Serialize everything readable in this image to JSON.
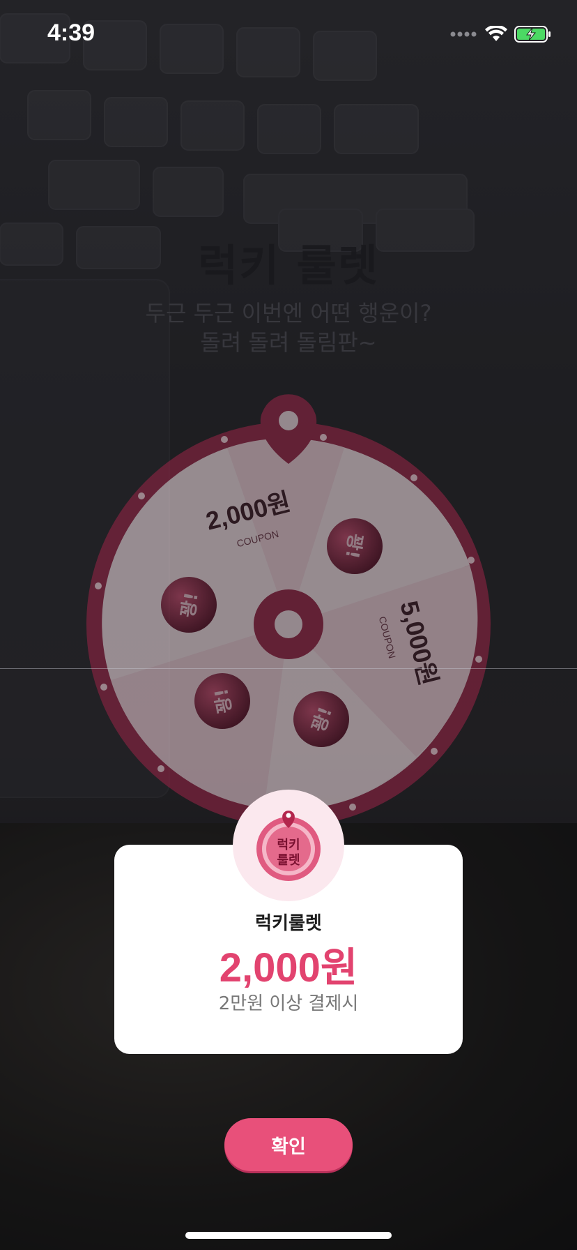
{
  "status_bar": {
    "time": "4:39"
  },
  "header": {
    "title": "럭키 룰렛",
    "subtitle_line1": "두근 두근 이번엔 어떤 행운이?",
    "subtitle_line2": "돌려 돌려 돌림판~"
  },
  "wheel": {
    "segments": [
      {
        "label": "2,000원",
        "sublabel": "COUPON"
      },
      {
        "label": "꽝!"
      },
      {
        "label": "5,000원",
        "sublabel": "COUPON"
      },
      {
        "label": "꽝!"
      },
      {
        "label": "꽝!"
      },
      {
        "label": "꽝!"
      }
    ]
  },
  "result_card": {
    "badge_text_line1": "럭키",
    "badge_text_line2": "룰렛",
    "name": "럭키룰렛",
    "amount": "2,000원",
    "condition": "2만원 이상 결제시"
  },
  "confirm_button": {
    "label": "확인"
  },
  "colors": {
    "accent": "#e8507a",
    "amount": "#e2436f",
    "wheel_rim": "#8a1e3c"
  },
  "icons": [
    "signal-icon",
    "wifi-icon",
    "battery-icon",
    "roulette-pin-icon"
  ]
}
